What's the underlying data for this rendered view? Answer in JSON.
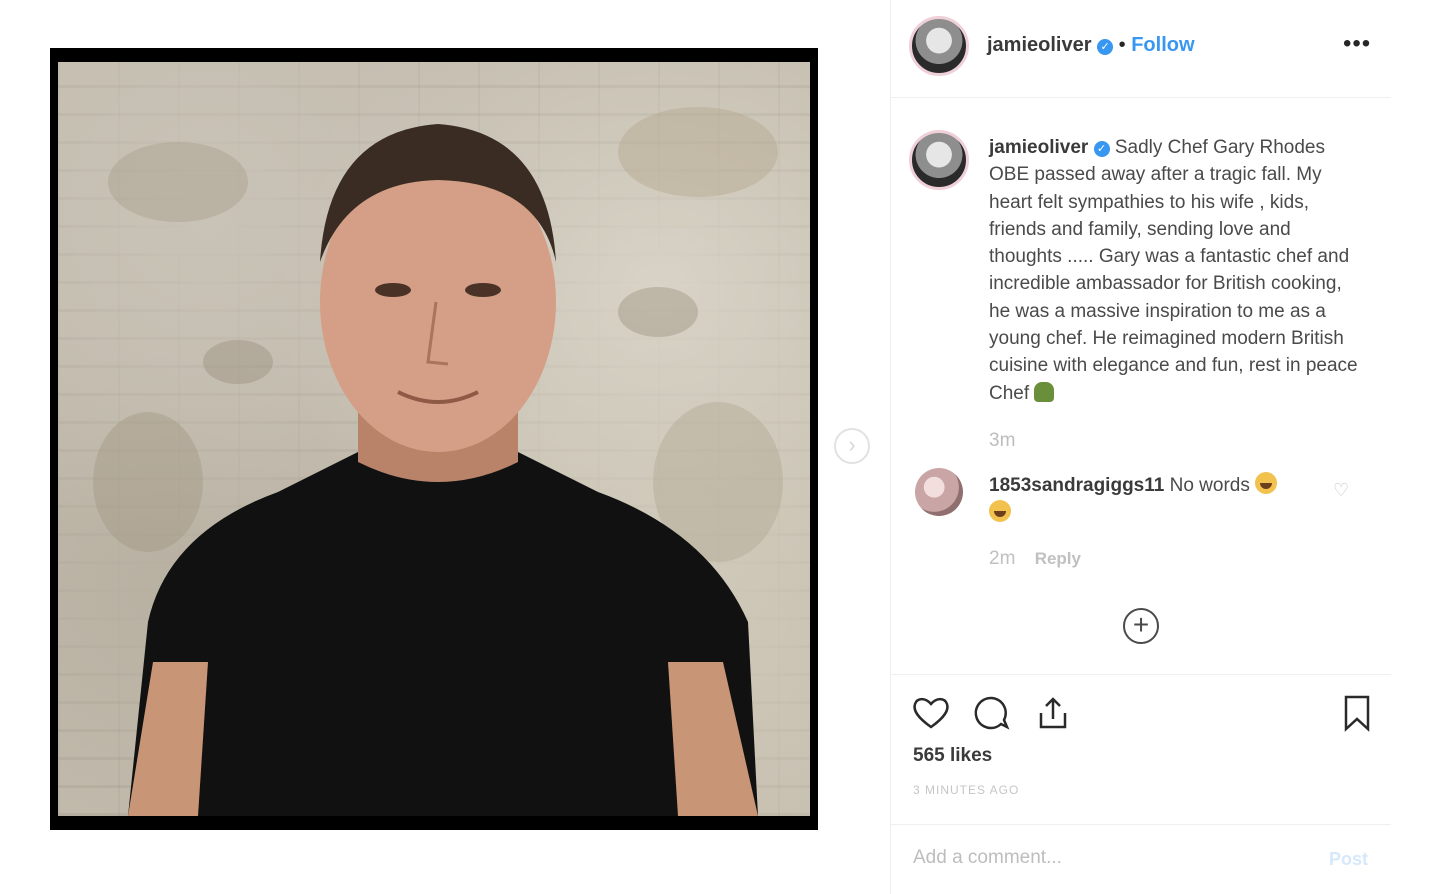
{
  "post": {
    "username": "jamieoliver",
    "follow_label": "Follow",
    "separator": "•",
    "more_icon": "more-options-icon",
    "caption": "Sadly Chef Gary Rhodes OBE passed away after a tragic fall. My heart felt sympathies to his wife , kids, friends and family, sending love and thoughts ..... Gary was a fantastic chef and incredible ambassador for British cooking, he was a massive inspiration to me as a young chef. He reimagined modern British cuisine with elegance and fun, rest in peace Chef",
    "caption_time": "3m"
  },
  "comment": {
    "username": "1853sandragiggs11",
    "text": "No words",
    "time": "2m",
    "reply_label": "Reply"
  },
  "actions": {
    "likes": "565 likes",
    "posted_ago": "3 MINUTES AGO"
  },
  "add_comment": {
    "placeholder": "Add a comment...",
    "post_label": "Post"
  },
  "colors": {
    "accent": "#3897f0",
    "text": "#262626",
    "muted": "#bdbdbd"
  }
}
